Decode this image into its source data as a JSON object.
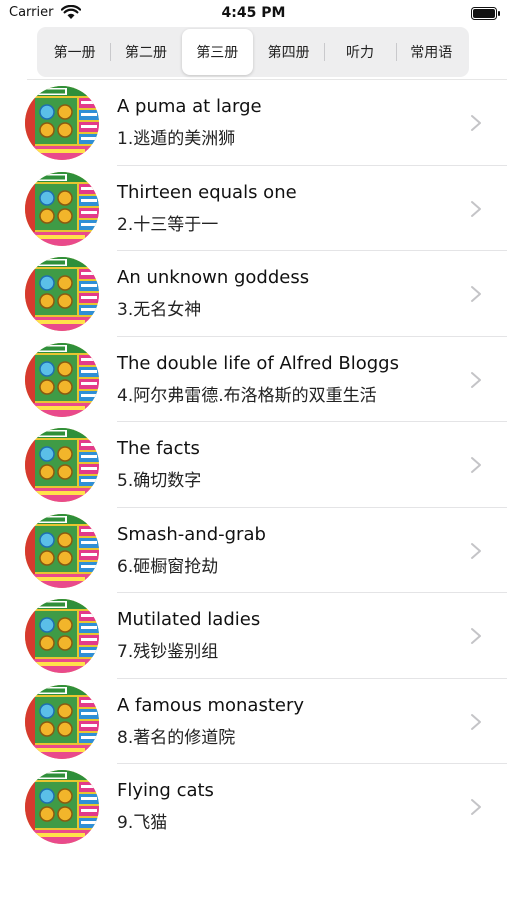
{
  "status_bar": {
    "carrier": "Carrier",
    "time": "4:45 PM"
  },
  "segments": {
    "selected_index": 2,
    "items": [
      "第一册",
      "第二册",
      "第三册",
      "第四册",
      "听力",
      "常用语"
    ]
  },
  "lessons": [
    {
      "title": "A puma at large",
      "subtitle": "1.逃遁的美洲狮"
    },
    {
      "title": "Thirteen equals one",
      "subtitle": "2.十三等于一"
    },
    {
      "title": "An unknown goddess",
      "subtitle": "3.无名女神"
    },
    {
      "title": "The double life of Alfred Bloggs",
      "subtitle": "4.阿尔弗雷德.布洛格斯的双重生活"
    },
    {
      "title": "The facts",
      "subtitle": "5.确切数字"
    },
    {
      "title": "Smash-and-grab",
      "subtitle": "6.砸橱窗抢劫"
    },
    {
      "title": "Mutilated ladies",
      "subtitle": "7.残钞鉴别组"
    },
    {
      "title": "A famous monastery",
      "subtitle": "8.著名的修道院"
    },
    {
      "title": "Flying cats",
      "subtitle": "9.飞猫"
    }
  ],
  "colors": {
    "chevron": "#c4c4c7",
    "segment_bg": "#eeeeef",
    "separator": "#e4e4e6"
  }
}
